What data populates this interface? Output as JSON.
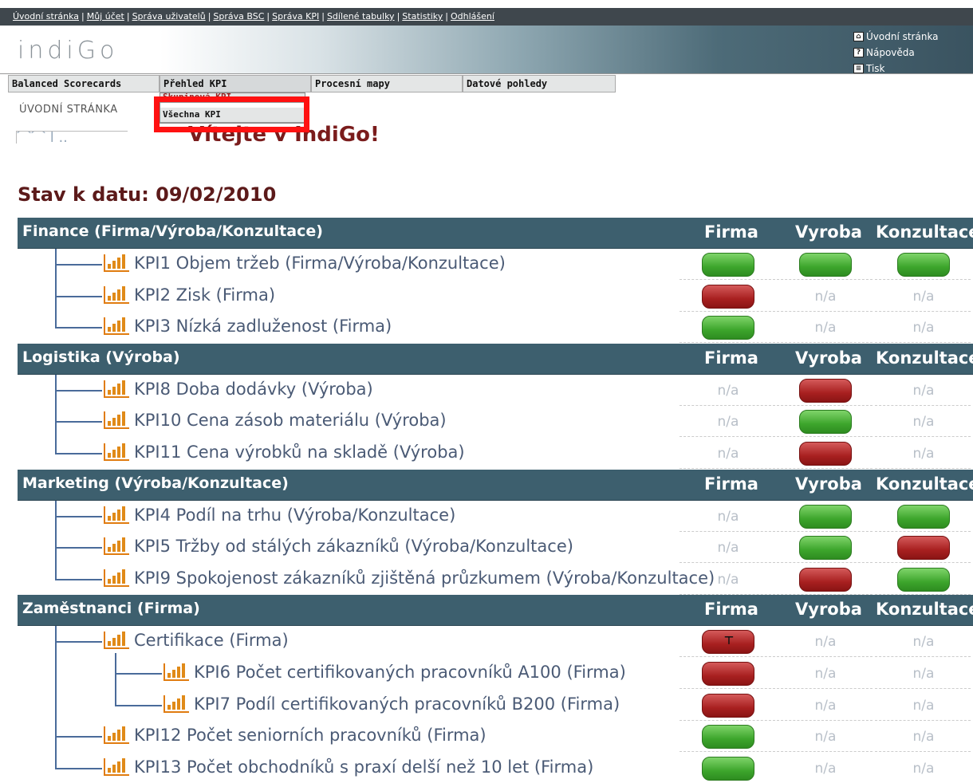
{
  "toplinks": [
    "Úvodní stránka",
    "Můj účet",
    "Správa uživatelů",
    "Správa BSC",
    "Správa KPI",
    "Sdílené tabulky",
    "Statistiky",
    "Odhlášení"
  ],
  "logo": "indiGo",
  "header_links": [
    {
      "label": "Úvodní stránka",
      "icon": "home-icon"
    },
    {
      "label": "Nápověda",
      "icon": "help-icon"
    },
    {
      "label": "Tisk",
      "icon": "print-icon"
    }
  ],
  "nav": [
    "Balanced Scorecards",
    "Přehled KPI",
    "Procesní mapy",
    "Datové pohledy"
  ],
  "dropdown": [
    "Skupinová KPI",
    "Všechna KPI"
  ],
  "breadcrumb": "ÚVODNÍ STRÁNKA",
  "welcome": "Vítejte v IndiGo!",
  "date_title": "Stav k datu: 09/02/2010",
  "columns": [
    "Firma",
    "Vyroba",
    "Konzultace"
  ],
  "na_text": "n/a",
  "categories": [
    {
      "name": "Finance (Firma/Výroba/Konzultace)",
      "kpis": [
        {
          "label": "KPI1 Objem tržeb (Firma/Výroba/Konzultace)",
          "status": [
            "green",
            "green",
            "green"
          ]
        },
        {
          "label": "KPI2 Zisk (Firma)",
          "status": [
            "red",
            "na",
            "na"
          ]
        },
        {
          "label": "KPI3 Nízká zadluženost (Firma)",
          "status": [
            "green",
            "na",
            "na"
          ]
        }
      ]
    },
    {
      "name": "Logistika (Výroba)",
      "kpis": [
        {
          "label": "KPI8 Doba dodávky (Výroba)",
          "status": [
            "na",
            "red",
            "na"
          ]
        },
        {
          "label": "KPI10 Cena zásob materiálu (Výroba)",
          "status": [
            "na",
            "green",
            "na"
          ]
        },
        {
          "label": "KPI11 Cena výrobků na skladě (Výroba)",
          "status": [
            "na",
            "red",
            "na"
          ]
        }
      ]
    },
    {
      "name": "Marketing (Výroba/Konzultace)",
      "kpis": [
        {
          "label": "KPI4 Podíl na trhu (Výroba/Konzultace)",
          "status": [
            "na",
            "green",
            "green"
          ]
        },
        {
          "label": "KPI5 Tržby od stálých zákazníků (Výroba/Konzultace)",
          "status": [
            "na",
            "green",
            "red"
          ]
        },
        {
          "label": "KPI9 Spokojenost zákazníků zjištěná průzkumem (Výroba/Konzultace)",
          "status": [
            "na",
            "red",
            "green"
          ]
        }
      ]
    },
    {
      "name": "Zaměstnanci (Firma)",
      "kpis": [
        {
          "label": "Certifikace (Firma)",
          "status": [
            "red-tree",
            "na",
            "na"
          ]
        },
        {
          "label": "KPI6 Počet certifikovaných pracovníků A100 (Firma)",
          "status": [
            "red",
            "na",
            "na"
          ],
          "child": true
        },
        {
          "label": "KPI7 Podíl certifikovaných pracovníků B200 (Firma)",
          "status": [
            "red",
            "na",
            "na"
          ],
          "child": true
        },
        {
          "label": "KPI12 Počet seniorních pracovníků (Firma)",
          "status": [
            "green",
            "na",
            "na"
          ]
        },
        {
          "label": "KPI13 Počet obchodníků s praxí delší než 10 let (Firma)",
          "status": [
            "green",
            "na",
            "na"
          ]
        }
      ]
    }
  ]
}
